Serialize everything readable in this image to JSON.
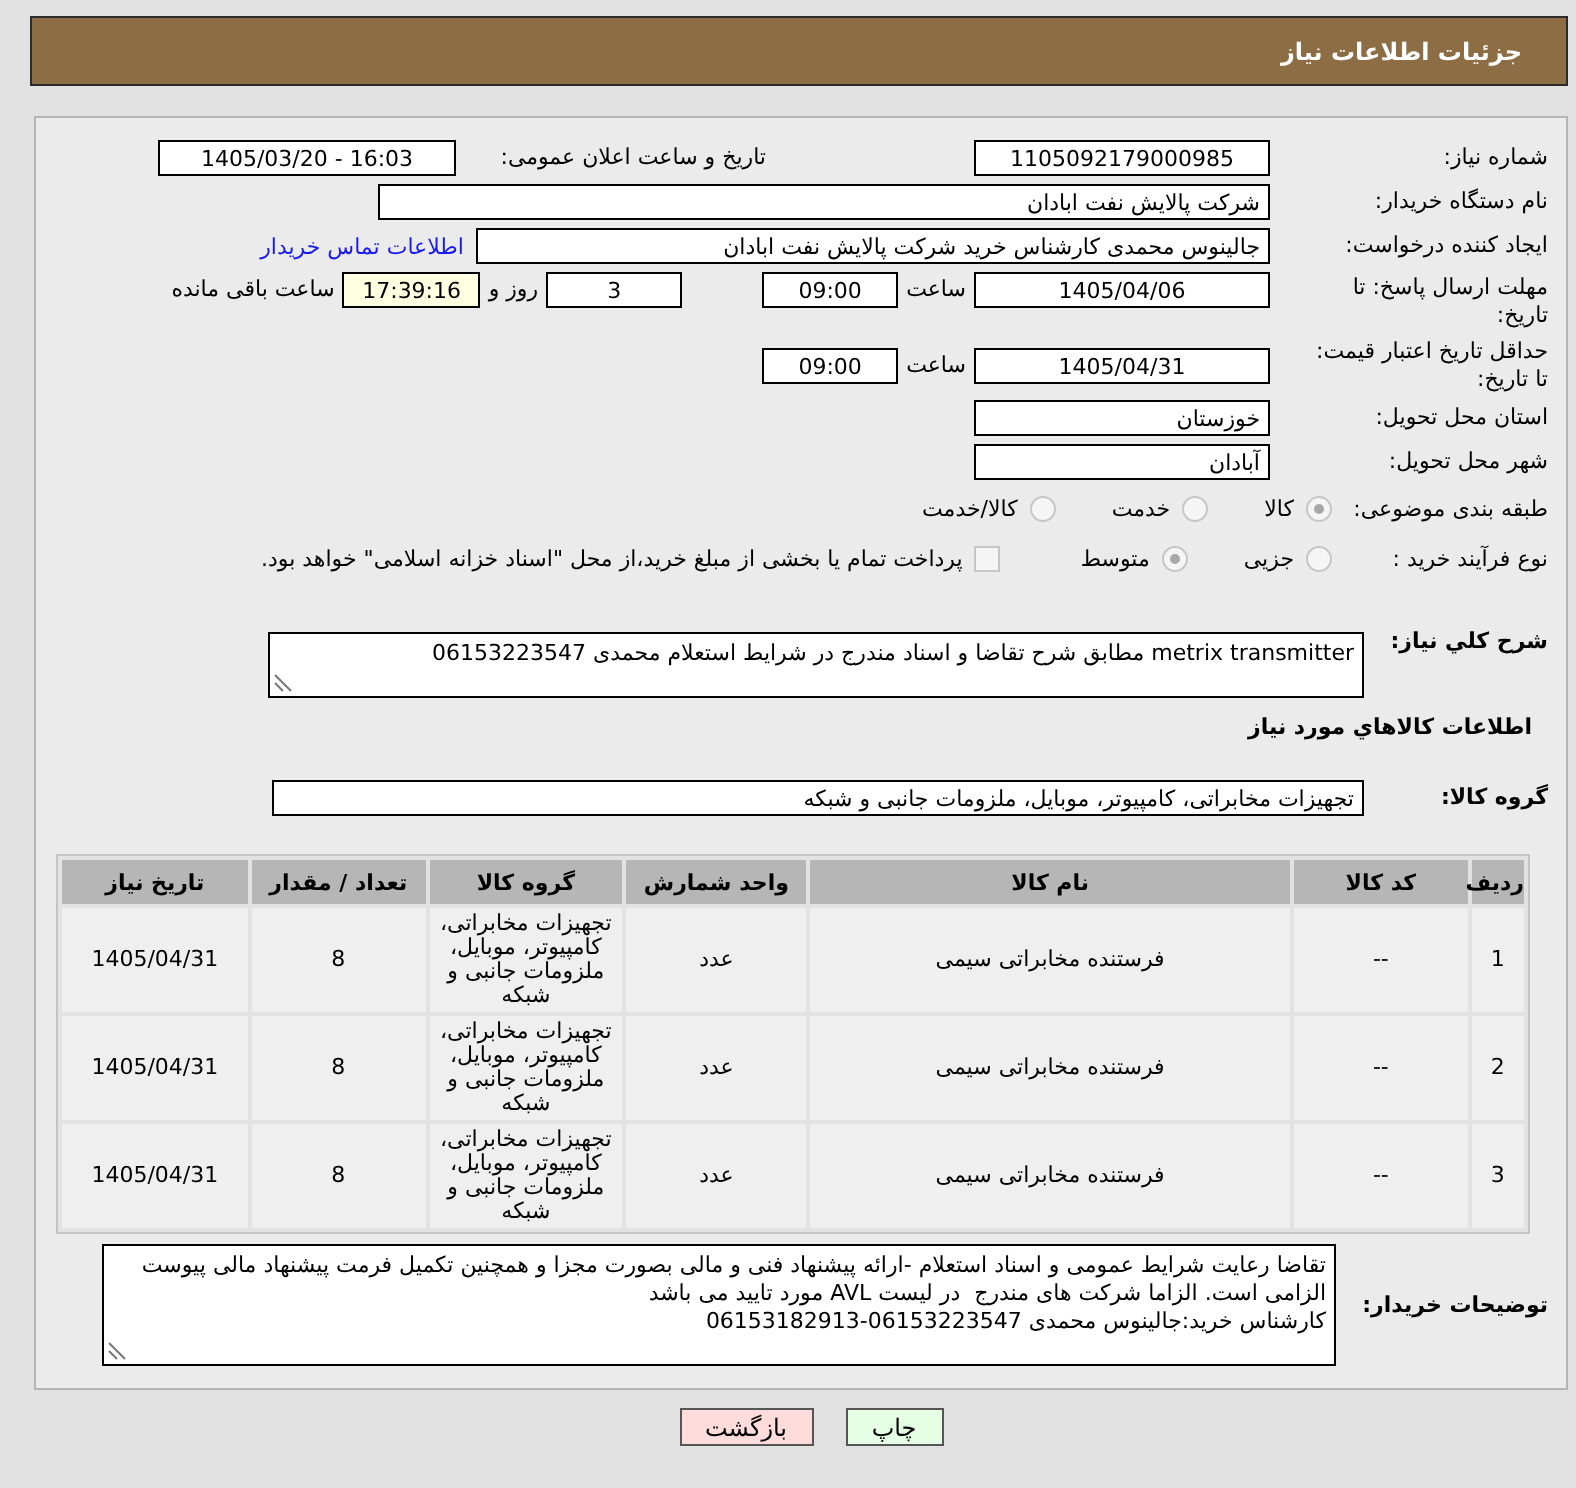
{
  "header": {
    "title": "جزئیات اطلاعات نیاز"
  },
  "need_number": {
    "label": "شماره نیاز:",
    "value": "1105092179000985"
  },
  "announcement": {
    "label": "تاریخ و ساعت اعلان عمومی:",
    "value": "1405/03/20 - 16:03"
  },
  "buyer_org": {
    "label": "نام دستگاه خریدار:",
    "value": "شرکت پالایش نفت ابادان"
  },
  "requester": {
    "label": "ایجاد کننده درخواست:",
    "value": "جالینوس محمدی کارشناس خرید  شرکت پالایش نفت ابادان",
    "link": "اطلاعات تماس خریدار"
  },
  "response_deadline": {
    "label": "مهلت ارسال پاسخ: تا تاریخ:",
    "date": "1405/04/06",
    "time_label": "ساعت",
    "time": "09:00",
    "days": "3",
    "days_label": "روز و",
    "remaining": "17:39:16",
    "remaining_label": "ساعت باقی مانده"
  },
  "price_validity": {
    "label": "حداقل تاریخ اعتبار قیمت: تا تاریخ:",
    "date": "1405/04/31",
    "time_label": "ساعت",
    "time": "09:00"
  },
  "delivery_province": {
    "label": "استان محل تحویل:",
    "value": "خوزستان"
  },
  "delivery_city": {
    "label": "شهر محل تحویل:",
    "value": "آبادان"
  },
  "category": {
    "label": "طبقه بندی موضوعی:",
    "options": [
      {
        "label": "کالا",
        "selected": true
      },
      {
        "label": "خدمت",
        "selected": false
      },
      {
        "label": "کالا/خدمت",
        "selected": false
      }
    ]
  },
  "purchase_process": {
    "label": "نوع فرآیند خرید :",
    "options": [
      {
        "label": "جزیی",
        "selected": false
      },
      {
        "label": "متوسط",
        "selected": true
      }
    ],
    "treasury": {
      "label": "پرداخت تمام یا بخشی از مبلغ خرید،از محل \"اسناد خزانه اسلامی\" خواهد بود.",
      "checked": false
    }
  },
  "summary": {
    "label": "شرح کلي نياز:",
    "value": "metrix transmitter مطابق شرح تقاضا و اسناد مندرج در شرایط استعلام محمدی 06153223547"
  },
  "goods_section": {
    "title": "اطلاعات کالاهاي مورد نياز"
  },
  "goods_group": {
    "label": "گروه کالا:",
    "value": "تجهیزات مخابراتی، کامپیوتر، موبایل، ملزومات جانبی و شبکه"
  },
  "table": {
    "columns": [
      "ردیف",
      "کد کالا",
      "نام کالا",
      "واحد شمارش",
      "گروه کالا",
      "تعداد / مقدار",
      "تاریخ نیاز"
    ],
    "rows": [
      [
        "1",
        "--",
        "فرستنده مخابراتی سیمی",
        "عدد",
        "تجهیزات مخابراتی، کامپیوتر، موبایل، ملزومات جانبی و شبکه",
        "8",
        "1405/04/31"
      ],
      [
        "2",
        "--",
        "فرستنده مخابراتی سیمی",
        "عدد",
        "تجهیزات مخابراتی، کامپیوتر، موبایل، ملزومات جانبی و شبکه",
        "8",
        "1405/04/31"
      ],
      [
        "3",
        "--",
        "فرستنده مخابراتی سیمی",
        "عدد",
        "تجهیزات مخابراتی، کامپیوتر، موبایل، ملزومات جانبی و شبکه",
        "8",
        "1405/04/31"
      ]
    ]
  },
  "buyer_notes": {
    "label": "توضیحات خریدار:",
    "value": "تقاضا رعایت شرایط عمومی و اسناد استعلام -ارائه پیشنهاد فنی و مالی بصورت مجزا و همچنین تکمیل فرمت پیشنهاد مالی پیوست الزامی است. الزاما شرکت های مندرج  در لیست AVL مورد تایید می باشد\nکارشناس خرید:جالینوس محمدی 06153223547-06153182913"
  },
  "buttons": [
    {
      "label": "چاپ",
      "kind": "print"
    },
    {
      "label": "بازگشت",
      "kind": "back"
    }
  ]
}
